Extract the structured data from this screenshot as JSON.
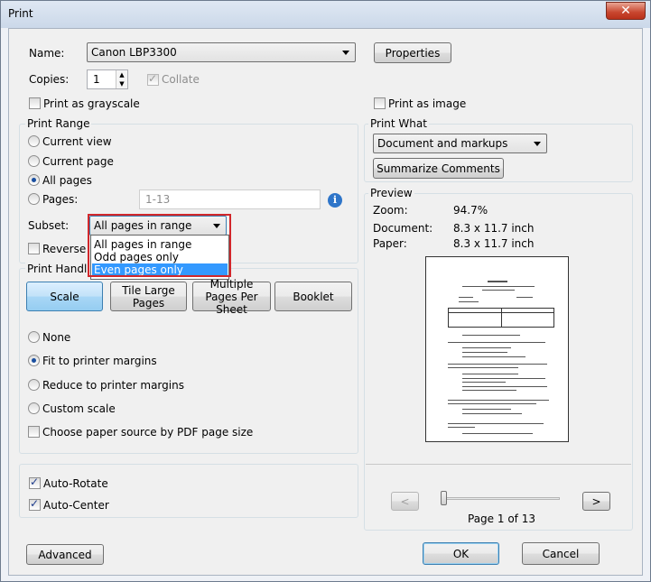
{
  "window": {
    "title": "Print",
    "close_icon": "close-icon"
  },
  "printer": {
    "name_label": "Name:",
    "name_value": "Canon LBP3300",
    "properties_label": "Properties",
    "copies_label": "Copies:",
    "copies_value": "1",
    "collate_label": "Collate",
    "grayscale_label": "Print as grayscale",
    "print_as_image_label": "Print as image"
  },
  "print_range": {
    "title": "Print Range",
    "current_view": "Current view",
    "current_page": "Current page",
    "all_pages": "All pages",
    "pages": "Pages:",
    "pages_placeholder": "1-13",
    "info_icon": "info-icon",
    "subset_label": "Subset:",
    "subset_value": "All pages in range",
    "subset_options": [
      "All pages in range",
      "Odd pages only",
      "Even pages only"
    ],
    "reverse_label": "Reverse"
  },
  "print_what": {
    "title": "Print What",
    "value": "Document and markups",
    "summarize_label": "Summarize Comments"
  },
  "handling": {
    "title": "Print Handling",
    "scale": "Scale",
    "tile_large_pages": "Tile Large Pages",
    "multiple_pages": "Multiple Pages Per Sheet",
    "booklet": "Booklet",
    "none": "None",
    "fit": "Fit to printer margins",
    "reduce": "Reduce to printer margins",
    "custom": "Custom scale",
    "paper_source": "Choose paper source by PDF page size"
  },
  "orientation": {
    "auto_rotate": "Auto-Rotate",
    "auto_center": "Auto-Center"
  },
  "preview": {
    "title": "Preview",
    "zoom_label": "Zoom:",
    "zoom_value": "94.7%",
    "document_label": "Document:",
    "document_value": "8.3 x 11.7 inch",
    "paper_label": "Paper:",
    "paper_value": "8.3 x 11.7 inch",
    "page_text": "Page 1 of 13",
    "prev_label": "<",
    "next_label": ">"
  },
  "footer": {
    "advanced": "Advanced",
    "ok": "OK",
    "cancel": "Cancel"
  }
}
